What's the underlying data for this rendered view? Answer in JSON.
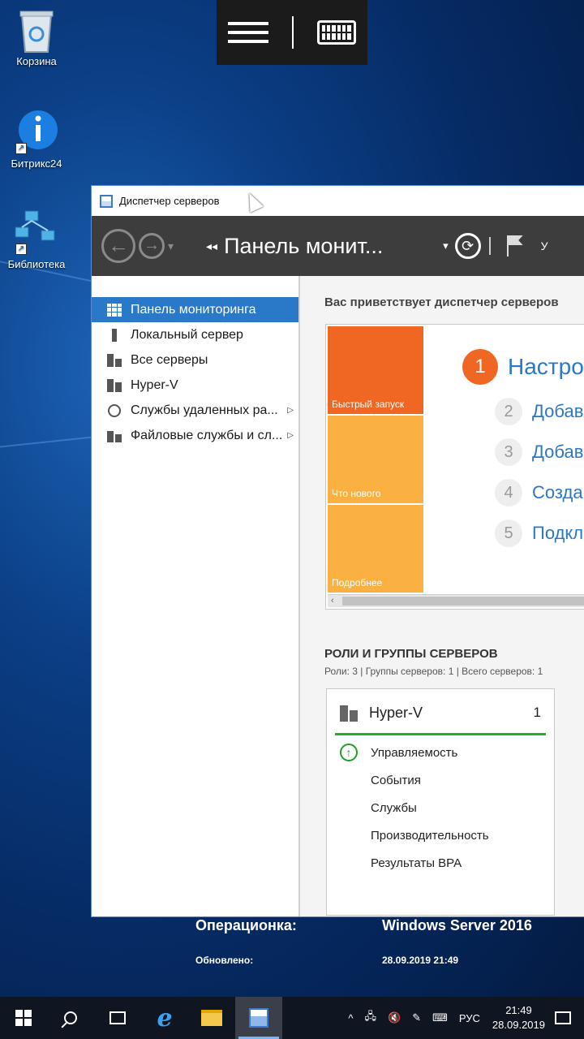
{
  "desktop": {
    "icons": [
      {
        "label": "Корзина"
      },
      {
        "label": "Битрикс24"
      },
      {
        "label": "Библиотека"
      }
    ],
    "bginfo": {
      "os_label": "Операционка:",
      "os_value": "Windows Server 2016",
      "updated_label": "Обновлено:",
      "updated_value": "28.09.2019 21:49"
    }
  },
  "window": {
    "title": "Диспетчер серверов",
    "breadcrumb": "Панель монит...",
    "menu_partial": "У",
    "sidebar": [
      {
        "label": "Панель мониторинга"
      },
      {
        "label": "Локальный сервер"
      },
      {
        "label": "Все серверы"
      },
      {
        "label": "Hyper-V"
      },
      {
        "label": "Службы удаленных ра..."
      },
      {
        "label": "Файловые службы и сл..."
      }
    ],
    "welcome": "Вас приветствует диспетчер серверов",
    "tiles": [
      "Быстрый запуск",
      "Что нового",
      "Подробнее"
    ],
    "quickstart": {
      "main_num": "1",
      "main_text": "Настро",
      "steps": [
        {
          "num": "2",
          "text": "Добав"
        },
        {
          "num": "3",
          "text": "Добав"
        },
        {
          "num": "4",
          "text": "Созда"
        },
        {
          "num": "5",
          "text": "Подкл"
        }
      ]
    },
    "roles": {
      "heading": "РОЛИ И ГРУППЫ СЕРВЕРОВ",
      "subtitle": "Роли: 3 | Группы серверов: 1 | Всего серверов: 1",
      "card": {
        "title": "Hyper-V",
        "count": "1",
        "rows": [
          "Управляемость",
          "События",
          "Службы",
          "Производительность",
          "Результаты BPA"
        ]
      }
    }
  },
  "taskbar": {
    "lang": "РУС",
    "time": "21:49",
    "date": "28.09.2019"
  }
}
